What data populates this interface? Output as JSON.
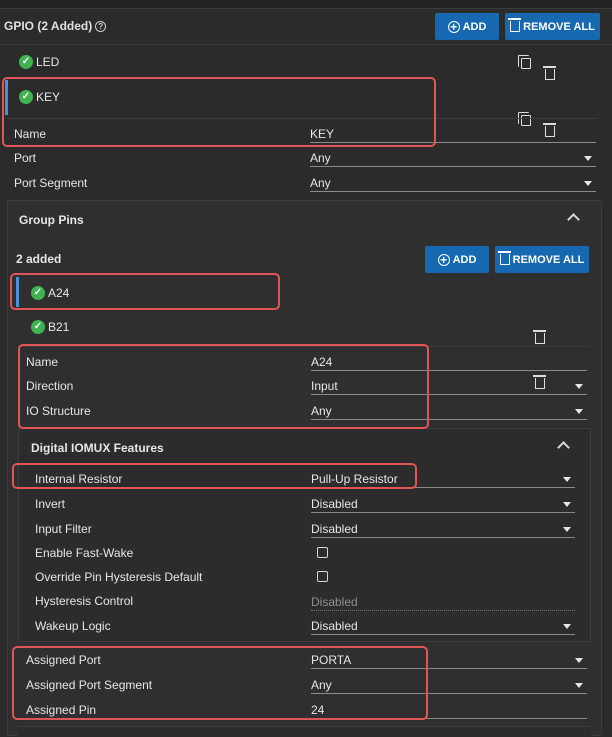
{
  "gpio": {
    "title": "GPIO (2 Added)",
    "help_glyph": "?",
    "add_label": "ADD",
    "remove_all_label": "REMOVE ALL",
    "items": [
      {
        "label": "LED"
      },
      {
        "label": "KEY"
      }
    ],
    "fields": {
      "name_label": "Name",
      "name_value": "KEY",
      "port_label": "Port",
      "port_value": "Any",
      "port_segment_label": "Port Segment",
      "port_segment_value": "Any"
    }
  },
  "group_pins": {
    "title": "Group Pins",
    "added_text": "2 added",
    "add_label": "ADD",
    "remove_all_label": "REMOVE ALL",
    "items": [
      {
        "label": "A24"
      },
      {
        "label": "B21"
      }
    ],
    "fields": {
      "name_label": "Name",
      "name_value": "A24",
      "direction_label": "Direction",
      "direction_value": "Input",
      "io_structure_label": "IO Structure",
      "io_structure_value": "Any"
    }
  },
  "iomux": {
    "title": "Digital IOMUX Features",
    "internal_resistor_label": "Internal Resistor",
    "internal_resistor_value": "Pull-Up Resistor",
    "invert_label": "Invert",
    "invert_value": "Disabled",
    "input_filter_label": "Input Filter",
    "input_filter_value": "Disabled",
    "fast_wake_label": "Enable Fast-Wake",
    "fast_wake_checked": false,
    "hysteresis_override_label": "Override Pin Hysteresis Default",
    "hysteresis_override_checked": false,
    "hysteresis_control_label": "Hysteresis Control",
    "hysteresis_control_value": "Disabled",
    "wakeup_logic_label": "Wakeup Logic",
    "wakeup_logic_value": "Disabled"
  },
  "assigned": {
    "port_label": "Assigned Port",
    "port_value": "PORTA",
    "segment_label": "Assigned Port Segment",
    "segment_value": "Any",
    "pin_label": "Assigned Pin",
    "pin_value": "24"
  },
  "colors": {
    "accent": "#1669b0",
    "highlight": "#e05555",
    "check": "#3fb34f",
    "selection_bar": "#4a8fd8"
  },
  "icons": {
    "add": "add-circle-icon",
    "remove_all": "remove-all-icon",
    "copy": "copy-icon",
    "delete": "delete-icon",
    "check": "check-circle-icon",
    "chevron": "chevron-up-icon",
    "caret": "caret-down-icon"
  }
}
